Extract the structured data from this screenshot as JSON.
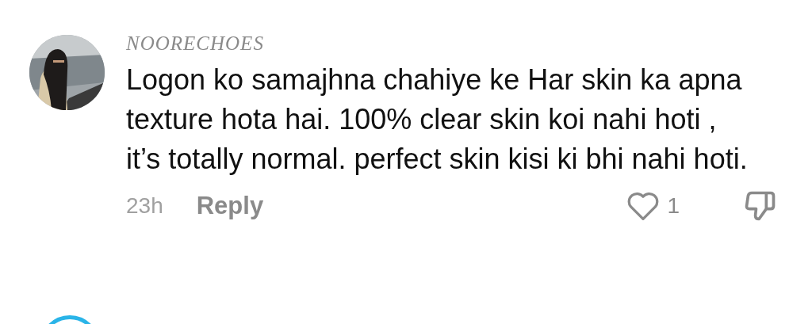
{
  "comment": {
    "username": "NOORECHOES",
    "text": "Logon ko samajhna chahiye ke Har skin ka apna texture hota hai. 100% clear skin koi nahi hoti , it’s totally normal. perfect skin kisi ki bhi nahi hoti.",
    "time": "23h",
    "reply": "Reply",
    "likes": "1",
    "liked": false
  }
}
